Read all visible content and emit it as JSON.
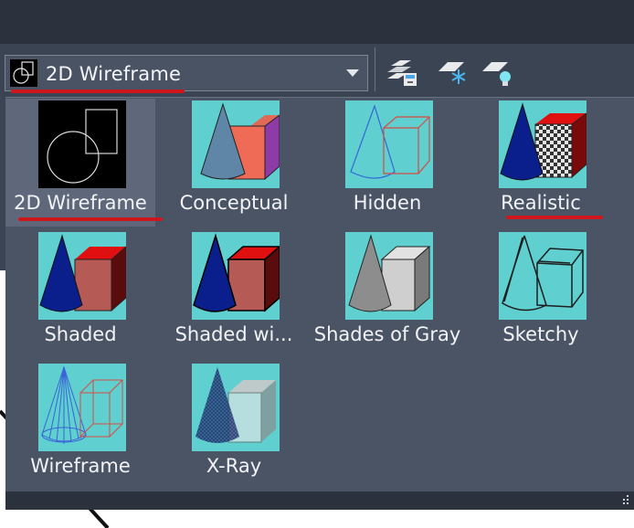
{
  "dropdown": {
    "current_value": "2D Wireframe",
    "thumb_icon": "2d-wireframe-thumb-icon",
    "chevron_icon": "chevron-down-icon"
  },
  "toolbar": {
    "icons": [
      "layer-manager-icon",
      "freeze-layer-icon",
      "lightbulb-layer-icon"
    ]
  },
  "gallery": {
    "items": [
      {
        "label": "2D Wireframe",
        "icon": "2d-wireframe-style-icon",
        "selected": true
      },
      {
        "label": "Conceptual",
        "icon": "conceptual-style-icon"
      },
      {
        "label": "Hidden",
        "icon": "hidden-style-icon"
      },
      {
        "label": "Realistic",
        "icon": "realistic-style-icon"
      },
      {
        "label": "Shaded",
        "icon": "shaded-style-icon"
      },
      {
        "label": "Shaded wi...",
        "icon": "shaded-with-edges-style-icon"
      },
      {
        "label": "Shades of Gray",
        "icon": "shades-of-gray-style-icon"
      },
      {
        "label": "Sketchy",
        "icon": "sketchy-style-icon"
      },
      {
        "label": "Wireframe",
        "icon": "wireframe-style-icon"
      },
      {
        "label": "X-Ray",
        "icon": "x-ray-style-icon"
      }
    ]
  },
  "annotations": {
    "underline_color": "#d0161d"
  },
  "colors": {
    "panel_bg": "#4b5465",
    "tile_bg": "#5fcfcf",
    "selected_tile_bg": "#5f687a",
    "header_bg": "#2b313d"
  }
}
